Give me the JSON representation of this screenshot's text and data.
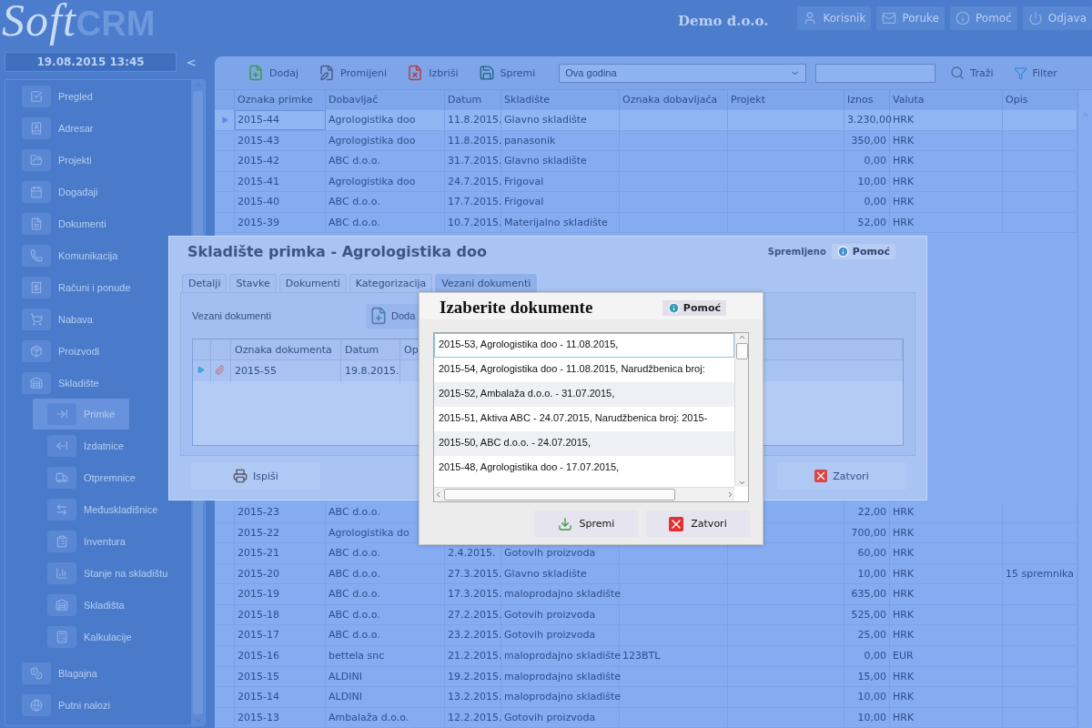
{
  "header": {
    "logo": {
      "script": "Soft",
      "bold": "CRM"
    },
    "company": "Demo d.o.o.",
    "buttons": [
      {
        "kind": "user",
        "label": "Korisnik"
      },
      {
        "kind": "mail",
        "label": "Poruke"
      },
      {
        "kind": "info",
        "label": "Pomoć"
      },
      {
        "kind": "power",
        "label": "Odjava"
      }
    ]
  },
  "sidebar": {
    "datetime": "19.08.2015 13:45",
    "collapse": "<",
    "items": [
      {
        "kind": "check",
        "label": "Pregled",
        "selected": false
      },
      {
        "kind": "book",
        "label": "Adresar",
        "selected": false
      },
      {
        "kind": "folder",
        "label": "Projekti",
        "selected": false
      },
      {
        "kind": "calendar",
        "label": "Događaji",
        "selected": false
      },
      {
        "kind": "file",
        "label": "Dokumenti",
        "selected": false
      },
      {
        "kind": "phone",
        "label": "Komunikacija",
        "selected": false
      },
      {
        "kind": "receipt",
        "label": "Računi i ponude",
        "selected": false
      },
      {
        "kind": "cart",
        "label": "Nabava",
        "selected": false
      },
      {
        "kind": "box",
        "label": "Proizvodi",
        "selected": false
      },
      {
        "kind": "shelf",
        "label": "Skladište",
        "selected": false,
        "children": [
          {
            "kind": "in",
            "label": "Primke",
            "selected": true
          },
          {
            "kind": "out",
            "label": "Izdatnice",
            "selected": false
          },
          {
            "kind": "truck",
            "label": "Otpremnice",
            "selected": false
          },
          {
            "kind": "swap",
            "label": "Međuskladišnice",
            "selected": false
          },
          {
            "kind": "list",
            "label": "Inventura",
            "selected": false
          },
          {
            "kind": "chart",
            "label": "Stanje na skladištu",
            "selected": false
          },
          {
            "kind": "shelf",
            "label": "Skladišta",
            "selected": false
          },
          {
            "kind": "calc",
            "label": "Kalkulacije",
            "selected": false
          }
        ]
      },
      {
        "kind": "coins",
        "label": "Blagajna",
        "selected": false
      },
      {
        "kind": "globe",
        "label": "Putni nalozi",
        "selected": false
      }
    ]
  },
  "toolbar": {
    "buttons": [
      {
        "kind": "add",
        "label": "Dodaj"
      },
      {
        "kind": "edit",
        "label": "Promijeni"
      },
      {
        "kind": "delete",
        "label": "Izbriši"
      },
      {
        "kind": "save",
        "label": "Spremi"
      }
    ],
    "period": "Ova godina",
    "search_button": "Traži",
    "filter_button": "Filter"
  },
  "table": {
    "columns": [
      "Oznaka primke",
      "Dobavljač",
      "Datum",
      "Skladište",
      "Oznaka dobavljača",
      "Projekt",
      "Iznos",
      "Valuta",
      "Opis"
    ],
    "rows": [
      {
        "selected": true,
        "cells": [
          "2015-44",
          "Agrologistika doo",
          "11.8.2015.",
          "Glavno skladište",
          "",
          "",
          "3.230,00",
          "HRK",
          ""
        ]
      },
      {
        "selected": false,
        "cells": [
          "2015-43",
          "Agrologistika doo",
          "11.8.2015.",
          "panasonik",
          "",
          "",
          "350,00",
          "HRK",
          ""
        ]
      },
      {
        "selected": false,
        "cells": [
          "2015-42",
          "ABC d.o.o.",
          "31.7.2015.",
          "Glavno skladište",
          "",
          "",
          "0,00",
          "HRK",
          ""
        ]
      },
      {
        "selected": false,
        "cells": [
          "2015-41",
          "Agrologistika doo",
          "24.7.2015.",
          "Frigoval",
          "",
          "",
          "10,00",
          "HRK",
          ""
        ]
      },
      {
        "selected": false,
        "cells": [
          "2015-40",
          "ABC d.o.o.",
          "17.7.2015.",
          "Frigoval",
          "",
          "",
          "0,00",
          "HRK",
          ""
        ]
      },
      {
        "selected": false,
        "cells": [
          "2015-39",
          "ABC d.o.o.",
          "10.7.2015.",
          "Materijalno skladište",
          "",
          "",
          "52,00",
          "HRK",
          ""
        ]
      }
    ],
    "rows_below": [
      {
        "selected": false,
        "cells": [
          "2015-23",
          "ABC d.o.o.",
          "",
          "",
          "",
          "",
          "22,00",
          "HRK",
          ""
        ]
      },
      {
        "selected": false,
        "cells": [
          "2015-22",
          "Agrologistika do",
          "",
          "",
          "",
          "",
          "700,00",
          "HRK",
          ""
        ]
      },
      {
        "selected": false,
        "cells": [
          "2015-21",
          "ABC d.o.o.",
          "2.4.2015.",
          "Gotovih proizvoda",
          "",
          "",
          "60,00",
          "HRK",
          ""
        ]
      },
      {
        "selected": false,
        "cells": [
          "2015-20",
          "ABC d.o.o.",
          "27.3.2015.",
          "Glavno skladište",
          "",
          "",
          "10,00",
          "HRK",
          "15 spremnika"
        ]
      },
      {
        "selected": false,
        "cells": [
          "2015-19",
          "ABC d.o.o.",
          "17.3.2015.",
          "maloprodajno skladište",
          "",
          "",
          "635,00",
          "HRK",
          ""
        ]
      },
      {
        "selected": false,
        "cells": [
          "2015-18",
          "ABC d.o.o.",
          "27.2.2015.",
          "Gotovih proizvoda",
          "",
          "",
          "525,00",
          "HRK",
          ""
        ]
      },
      {
        "selected": false,
        "cells": [
          "2015-17",
          "ABC d.o.o.",
          "23.2.2015.",
          "Gotovih proizvoda",
          "",
          "",
          "25,00",
          "HRK",
          ""
        ]
      },
      {
        "selected": false,
        "cells": [
          "2015-16",
          "bettela snc",
          "21.2.2015.",
          "maloprodajno skladište",
          "123BTL",
          "",
          "0,00",
          "EUR",
          ""
        ]
      },
      {
        "selected": false,
        "cells": [
          "2015-15",
          "ALDINI",
          "19.2.2015.",
          "maloprodajno skladište",
          "",
          "",
          "15,00",
          "HRK",
          ""
        ]
      },
      {
        "selected": false,
        "cells": [
          "2015-14",
          "ALDINI",
          "13.2.2015.",
          "maloprodajno skladište",
          "",
          "",
          "10,00",
          "HRK",
          ""
        ]
      },
      {
        "selected": false,
        "cells": [
          "2015-13",
          "Ambalaža d.o.o.",
          "12.2.2015.",
          "Gotovih proizvoda",
          "",
          "",
          "10,00",
          "HRK",
          ""
        ]
      }
    ]
  },
  "dialog": {
    "title": "Skladište primka - Agrologistika doo",
    "status": "Spremljeno",
    "help": "Pomoć",
    "tabs": [
      {
        "label": "Detalji",
        "selected": false
      },
      {
        "label": "Stavke",
        "selected": false
      },
      {
        "label": "Dokumenti",
        "selected": false
      },
      {
        "label": "Kategorizacija",
        "selected": false
      },
      {
        "label": "Vezani dokumenti",
        "selected": true
      }
    ],
    "section_label": "Vezani dokumenti",
    "add_button": "Doda",
    "grid": {
      "columns": [
        "Oznaka dokumenta",
        "Datum",
        "Op"
      ],
      "rows": [
        {
          "selected": true,
          "cells": [
            "2015-55",
            "19.8.2015."
          ]
        }
      ]
    },
    "print_button": "Ispiši",
    "close_button": "Zatvori"
  },
  "picker": {
    "title": "Izaberite dokumente",
    "help": "Pomoć",
    "items": [
      {
        "text": "2015-53, Agrologistika doo - 11.08.2015,",
        "selected": true
      },
      {
        "text": "2015-54, Agrologistika doo - 11.08.2015,  Narudžbenica broj:",
        "selected": false
      },
      {
        "text": "2015-52, Ambalaža d.o.o. - 31.07.2015,",
        "selected": false
      },
      {
        "text": "2015-51, Aktiva ABC - 24.07.2015,  Narudžbenica broj: 2015-",
        "selected": false
      },
      {
        "text": "2015-50, ABC d.o.o. - 24.07.2015,",
        "selected": false
      },
      {
        "text": "2015-48, Agrologistika doo - 17.07.2015,",
        "selected": false
      }
    ],
    "save_button": "Spremi",
    "close_button": "Zatvori"
  }
}
